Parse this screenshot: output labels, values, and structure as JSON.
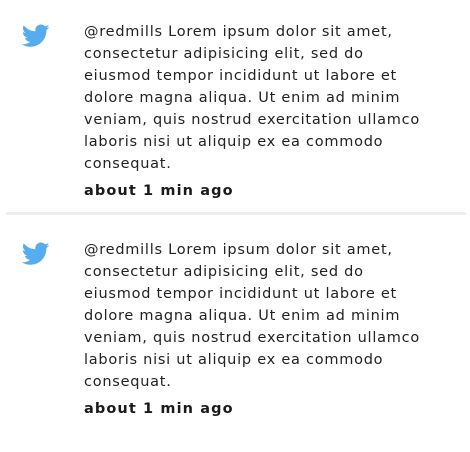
{
  "brand_color": "#55acee",
  "tweets": [
    {
      "icon": "twitter-bird-icon",
      "text": "@redmills Lorem ipsum dolor sit amet,\nconsectetur adipisicing elit, sed do\neiusmod tempor incididunt ut labore et\ndolore magna aliqua. Ut enim ad minim\nveniam, quis nostrud exercitation ullamco\nlaboris nisi ut aliquip ex ea commodo\nconsequat.",
      "time": "about 1 min ago"
    },
    {
      "icon": "twitter-bird-icon",
      "text": "@redmills Lorem ipsum dolor sit amet,\nconsectetur adipisicing elit, sed do\neiusmod tempor incididunt ut labore et\ndolore magna aliqua. Ut enim ad minim\nveniam, quis nostrud exercitation ullamco\nlaboris nisi ut aliquip ex ea commodo\nconsequat.",
      "time": "about 1 min ago"
    }
  ]
}
